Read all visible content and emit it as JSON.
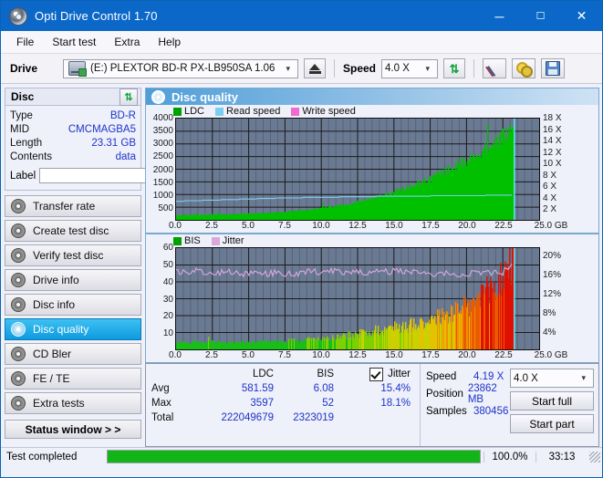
{
  "window": {
    "title": "Opti Drive Control 1.70",
    "icon": "disc-icon",
    "minimize": "─",
    "maximize": "☐",
    "close": "✕"
  },
  "menu": {
    "items": [
      "File",
      "Start test",
      "Extra",
      "Help"
    ]
  },
  "drivebar": {
    "drive_label": "Drive",
    "drive_value": "(E:)   PLEXTOR BD-R  PX-LB950SA 1.06",
    "eject_title": "eject",
    "speed_label": "Speed",
    "speed_value": "4.0 X",
    "refresh_title": "refresh",
    "erase_title": "erase",
    "keys_title": "keys",
    "save_title": "save"
  },
  "disc_panel": {
    "header": "Disc",
    "refresh_glyph": "⇅",
    "rows": [
      {
        "key": "Type",
        "value": "BD-R"
      },
      {
        "key": "MID",
        "value": "CMCMAGBA5"
      },
      {
        "key": "Length",
        "value": "23.31 GB"
      },
      {
        "key": "Contents",
        "value": "data"
      }
    ],
    "label_key": "Label",
    "label_value": "",
    "label_placeholder": ""
  },
  "sidebar": {
    "items": [
      {
        "label": "Transfer rate",
        "active": false
      },
      {
        "label": "Create test disc",
        "active": false
      },
      {
        "label": "Verify test disc",
        "active": false
      },
      {
        "label": "Drive info",
        "active": false
      },
      {
        "label": "Disc info",
        "active": false
      },
      {
        "label": "Disc quality",
        "active": true
      },
      {
        "label": "CD Bler",
        "active": false
      },
      {
        "label": "FE / TE",
        "active": false
      },
      {
        "label": "Extra tests",
        "active": false
      }
    ],
    "status_window_button": "Status window > >"
  },
  "main": {
    "header": "Disc quality"
  },
  "chart_data": [
    {
      "type": "area",
      "title": "Disc quality - LDC",
      "xlabel": "GB",
      "ylabel": "LDC",
      "legend": [
        {
          "name": "LDC",
          "color": "#00a000"
        },
        {
          "name": "Read speed",
          "color": "#7ecdf0"
        },
        {
          "name": "Write speed",
          "color": "#f06ad0"
        }
      ],
      "legend_position": "top-left",
      "grid": true,
      "xlim": [
        0,
        25.0
      ],
      "xticks": [
        "0.0",
        "2.5",
        "5.0",
        "7.5",
        "10.0",
        "12.5",
        "15.0",
        "17.5",
        "20.0",
        "22.5",
        "25.0 GB"
      ],
      "ylim": [
        0,
        4000
      ],
      "yticks": [
        "4000",
        "3500",
        "3000",
        "2500",
        "2000",
        "1500",
        "1000",
        "500"
      ],
      "y2label": "Speed",
      "y2lim": [
        0,
        18
      ],
      "y2ticks": [
        "18 X",
        "16 X",
        "14 X",
        "12 X",
        "10 X",
        "8 X",
        "6 X",
        "4 X",
        "2 X"
      ],
      "series": [
        {
          "name": "LDC",
          "color": "#00c000",
          "x": [
            0.0,
            1.0,
            2.0,
            3.0,
            4.0,
            5.0,
            6.0,
            7.0,
            8.0,
            9.0,
            10.0,
            11.0,
            12.0,
            13.0,
            14.0,
            15.0,
            16.0,
            17.0,
            18.0,
            19.0,
            20.0,
            21.0,
            22.0,
            22.8,
            23.2
          ],
          "values": [
            180,
            190,
            200,
            210,
            220,
            240,
            260,
            290,
            330,
            380,
            450,
            540,
            640,
            760,
            900,
            1080,
            1280,
            1500,
            1760,
            2050,
            2350,
            2700,
            3050,
            3400,
            3597
          ]
        },
        {
          "name": "Read speed",
          "color": "#7ecdf0",
          "x": [
            0.0,
            2.5,
            5.0,
            7.5,
            10.0,
            12.5,
            15.0,
            17.5,
            20.0,
            22.5,
            23.2
          ],
          "values": [
            3.3,
            3.5,
            3.7,
            3.9,
            4.0,
            4.1,
            4.2,
            4.25,
            4.3,
            4.4,
            4.4
          ]
        }
      ]
    },
    {
      "type": "area",
      "title": "Disc quality - BIS",
      "xlabel": "GB",
      "ylabel": "BIS",
      "legend": [
        {
          "name": "BIS",
          "color": "#00a000"
        },
        {
          "name": "Jitter",
          "color": "#dba8dd"
        }
      ],
      "legend_position": "top-left",
      "grid": true,
      "xlim": [
        0,
        25.0
      ],
      "xticks": [
        "0.0",
        "2.5",
        "5.0",
        "7.5",
        "10.0",
        "12.5",
        "15.0",
        "17.5",
        "20.0",
        "22.5",
        "25.0 GB"
      ],
      "ylim": [
        0,
        60
      ],
      "yticks": [
        "60",
        "50",
        "40",
        "30",
        "20",
        "10"
      ],
      "y2label": "Jitter",
      "y2lim": [
        0,
        20
      ],
      "y2ticks": [
        "20%",
        "16%",
        "12%",
        "8%",
        "4%"
      ],
      "series": [
        {
          "name": "BIS",
          "color": "gradient-green-red",
          "x": [
            0.0,
            2.0,
            4.0,
            6.0,
            8.0,
            10.0,
            12.0,
            14.0,
            16.0,
            18.0,
            20.0,
            22.0,
            23.2
          ],
          "values": [
            4,
            4,
            4,
            4,
            5,
            6,
            8,
            11,
            14,
            18,
            24,
            36,
            52
          ]
        },
        {
          "name": "Jitter",
          "color": "#dba8dd",
          "x": [
            0.0,
            2.5,
            5.0,
            7.5,
            10.0,
            12.5,
            15.0,
            17.5,
            20.0,
            22.5,
            23.2
          ],
          "values": [
            46,
            46,
            45,
            45,
            46,
            46,
            46,
            45,
            45,
            46,
            49
          ]
        }
      ]
    }
  ],
  "stats": {
    "headers": {
      "row": "",
      "ldc": "LDC",
      "bis": "BIS",
      "jitter": "Jitter"
    },
    "jitter_checked": true,
    "rows": [
      {
        "label": "Avg",
        "ldc": "581.59",
        "bis": "6.08",
        "jitter": "15.4%"
      },
      {
        "label": "Max",
        "ldc": "3597",
        "bis": "52",
        "jitter": "18.1%"
      },
      {
        "label": "Total",
        "ldc": "222049679",
        "bis": "2323019",
        "jitter": ""
      }
    ],
    "right": {
      "speed_label": "Speed",
      "speed_value": "4.19 X",
      "position_label": "Position",
      "position_value": "23862 MB",
      "samples_label": "Samples",
      "samples_value": "380456",
      "speed_select": "4.0 X",
      "start_full": "Start full",
      "start_part": "Start part"
    }
  },
  "statusbar": {
    "text": "Test completed",
    "progress_percent": 100,
    "percent_label": "100.0%",
    "time": "33:13"
  },
  "colors": {
    "accent": "#0b68c8",
    "value_text": "#1d34c8",
    "plot_bg": "#6b7a93",
    "ldc_green": "#00c000",
    "progress_green": "#12b417",
    "jitter_pink": "#dba8dd",
    "read_speed_blue": "#7ecdf0"
  }
}
